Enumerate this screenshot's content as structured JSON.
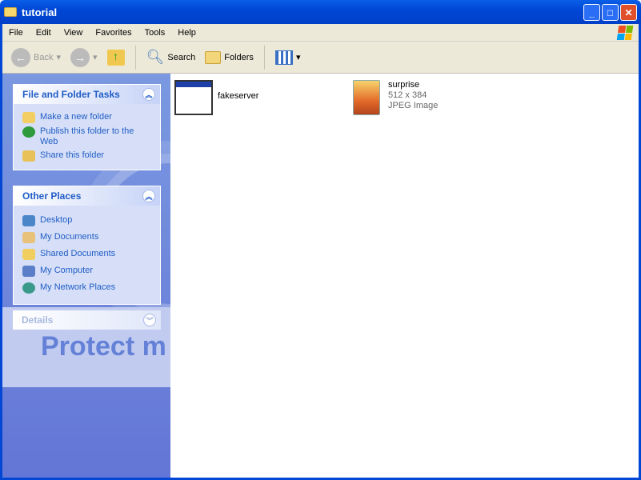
{
  "window": {
    "title": "tutorial",
    "buttons": [
      "_",
      "□",
      "✕"
    ]
  },
  "menu": [
    "File",
    "Edit",
    "View",
    "Favorites",
    "Tools",
    "Help"
  ],
  "toolbar": {
    "back": "Back",
    "search": "Search",
    "folders": "Folders"
  },
  "sidebar": {
    "tasks": {
      "title": "File and Folder Tasks",
      "items": [
        "Make a new folder",
        "Publish this folder to the Web",
        "Share this folder"
      ]
    },
    "places": {
      "title": "Other Places",
      "items": [
        "Desktop",
        "My Documents",
        "Shared Documents",
        "My Computer",
        "My Network Places"
      ]
    },
    "details": {
      "title": "Details"
    },
    "watermark": "Protect m"
  },
  "files": [
    {
      "name": "fakeserver",
      "icon": "exe-window-icon"
    },
    {
      "name": "surprise",
      "dims": "512 x 384",
      "type": "JPEG Image",
      "icon": "jpeg-image-icon"
    }
  ]
}
